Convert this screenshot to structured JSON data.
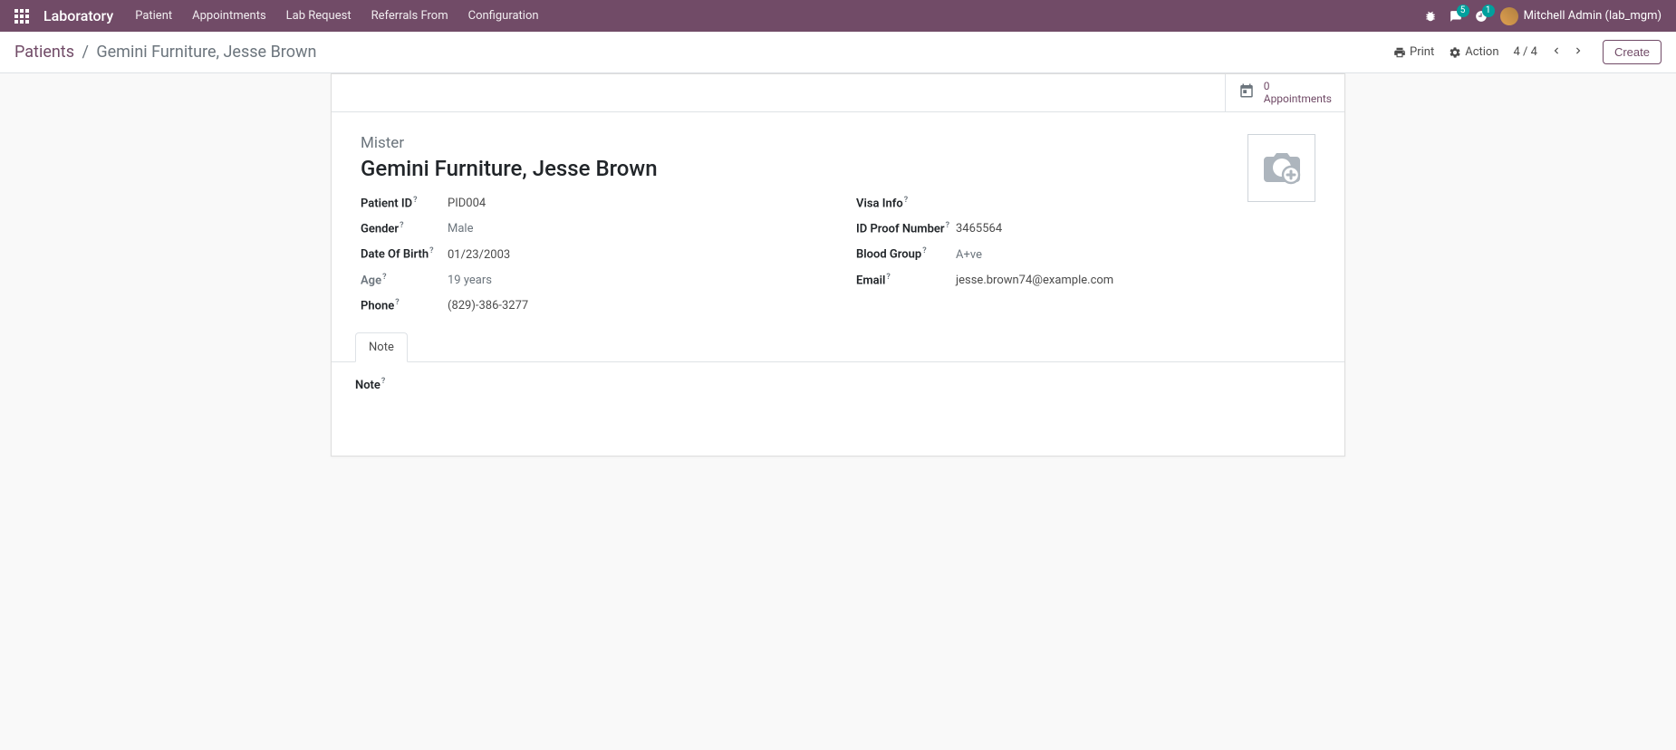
{
  "navbar": {
    "brand": "Laboratory",
    "menu": [
      "Patient",
      "Appointments",
      "Lab Request",
      "Referrals From",
      "Configuration"
    ],
    "messaging_badge": "5",
    "activity_badge": "1",
    "user_label": "Mitchell Admin (lab_mgm)"
  },
  "control": {
    "breadcrumb_root": "Patients",
    "breadcrumb_current": "Gemini Furniture, Jesse Brown",
    "print_label": "Print",
    "action_label": "Action",
    "pager": "4 / 4",
    "create_label": "Create"
  },
  "stat": {
    "count": "0",
    "label": "Appointments"
  },
  "record": {
    "salutation": "Mister",
    "title": "Gemini Furniture, Jesse Brown",
    "left": {
      "patient_id_label": "Patient ID",
      "patient_id": "PID004",
      "gender_label": "Gender",
      "gender": "Male",
      "dob_label": "Date Of Birth",
      "dob": "01/23/2003",
      "age_label": "Age",
      "age": "19 years",
      "phone_label": "Phone",
      "phone": "(829)-386-3277"
    },
    "right": {
      "visa_label": "Visa Info",
      "visa": "",
      "idproof_label": "ID Proof Number",
      "idproof": "3465564",
      "blood_label": "Blood Group",
      "blood": "A+ve",
      "email_label": "Email",
      "email": "jesse.brown74@example.com"
    }
  },
  "tabs": {
    "note_tab": "Note",
    "note_label": "Note"
  }
}
